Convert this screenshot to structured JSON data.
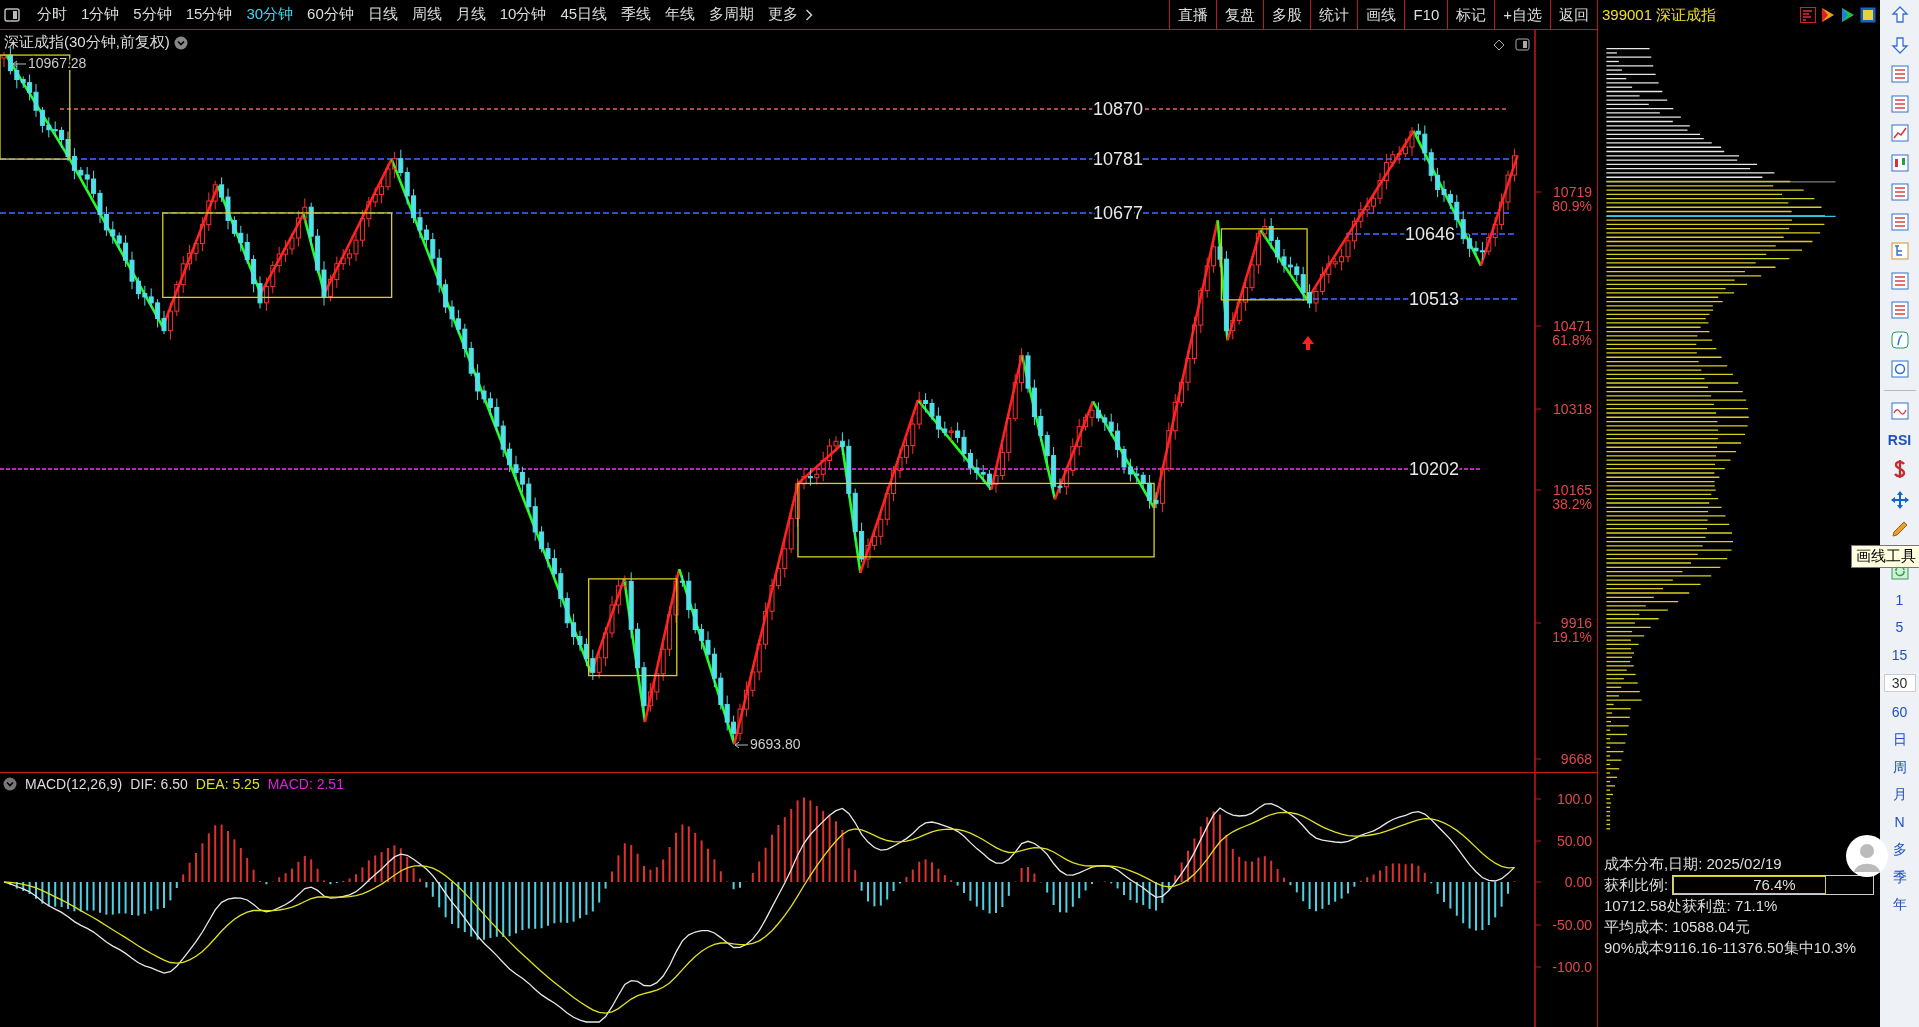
{
  "toolbar": {
    "periods": [
      {
        "label": "分时",
        "selected": false
      },
      {
        "label": "1分钟",
        "selected": false
      },
      {
        "label": "5分钟",
        "selected": false
      },
      {
        "label": "15分钟",
        "selected": false
      },
      {
        "label": "30分钟",
        "selected": true
      },
      {
        "label": "60分钟",
        "selected": false
      },
      {
        "label": "日线",
        "selected": false
      },
      {
        "label": "周线",
        "selected": false
      },
      {
        "label": "月线",
        "selected": false
      },
      {
        "label": "10分钟",
        "selected": false
      },
      {
        "label": "45日线",
        "selected": false
      },
      {
        "label": "季线",
        "selected": false
      },
      {
        "label": "年线",
        "selected": false
      },
      {
        "label": "多周期",
        "selected": false
      }
    ],
    "more": "更多",
    "actions": [
      "直播",
      "复盘",
      "多股",
      "统计",
      "画线",
      "F10",
      "标记",
      "+自选",
      "返回"
    ]
  },
  "quote": "399001 深证成指",
  "chart": {
    "title": "深证成指(30分钟,前复权)",
    "high_label": "10967.28",
    "low_label": "9693.80",
    "levels": [
      {
        "label": "10870",
        "color": "#b04848"
      },
      {
        "label": "10781",
        "color": "#3050d0"
      },
      {
        "label": "10677",
        "color": "#3050d0"
      },
      {
        "label": "10646",
        "color": "#3050d0"
      },
      {
        "label": "10513",
        "color": "#3050d0"
      },
      {
        "label": "10202",
        "color": "#c020c0"
      }
    ],
    "axis": [
      {
        "price": "10719",
        "pct": "80.9%"
      },
      {
        "price": "10471",
        "pct": "61.8%"
      },
      {
        "price": "10318"
      },
      {
        "price": "10165",
        "pct": "38.2%"
      },
      {
        "price": "9916",
        "pct": "19.1%"
      },
      {
        "price": "9668"
      }
    ]
  },
  "macd": {
    "name": "MACD(12,26,9)",
    "dif": "DIF: 6.50",
    "dea": "DEA: 5.25",
    "macd": "MACD: 2.51",
    "axis": [
      "100.0",
      "50.00",
      "0.00",
      "-50.00",
      "-100.0"
    ]
  },
  "cost": {
    "title": "成本分布,日期: 2025/02/19",
    "profit_label": "获利比例:",
    "profit_value": "76.4%",
    "level": 0.764,
    "lines": [
      "10712.58处获利盘: 71.1%",
      "平均成本: 10588.04元",
      "90%成本9116.16-11376.50集中10.3%"
    ]
  },
  "sidebar": {
    "indicator": "RSI",
    "tooltip": "画线工具",
    "periods": [
      {
        "label": "1",
        "selected": false
      },
      {
        "label": "5",
        "selected": false
      },
      {
        "label": "15",
        "selected": false
      },
      {
        "label": "30",
        "selected": true
      },
      {
        "label": "60",
        "selected": false
      },
      {
        "label": "日",
        "selected": false
      },
      {
        "label": "周",
        "selected": false
      },
      {
        "label": "月",
        "selected": false
      },
      {
        "label": "N",
        "selected": false
      },
      {
        "label": "多",
        "selected": false
      },
      {
        "label": "季",
        "selected": false
      },
      {
        "label": "年",
        "selected": false
      }
    ]
  }
}
